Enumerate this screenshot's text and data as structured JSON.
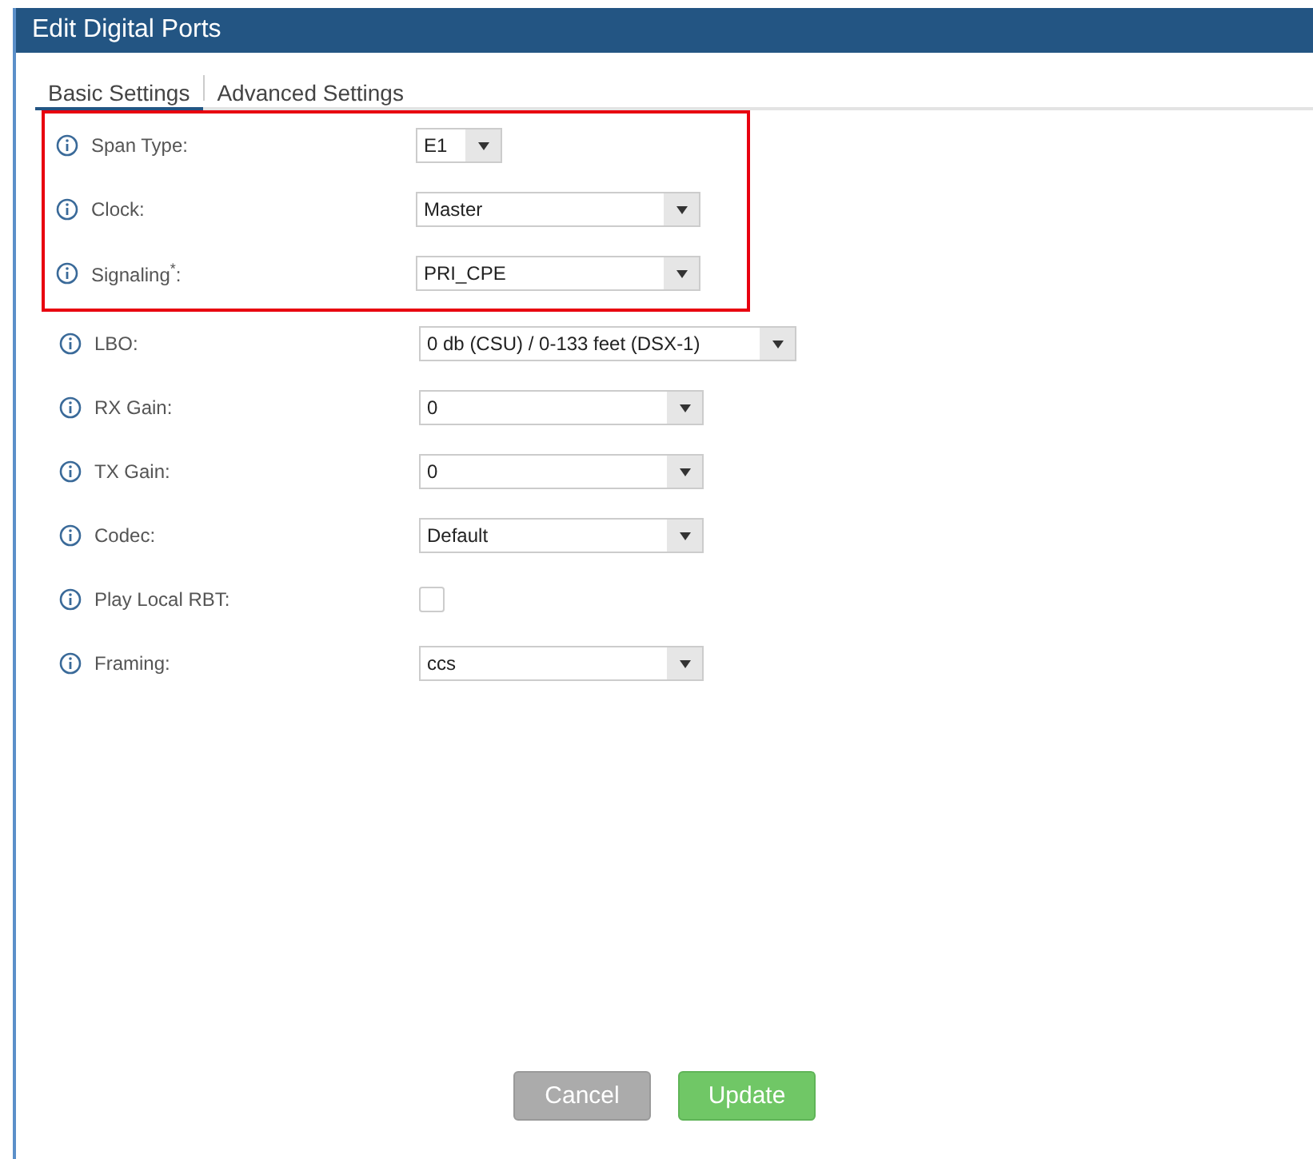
{
  "window": {
    "title": "Edit Digital Ports"
  },
  "tabs": [
    {
      "label": "Basic Settings",
      "selected": true
    },
    {
      "label": "Advanced Settings",
      "selected": false
    }
  ],
  "fields": [
    {
      "kind": "select",
      "label": "Span Type:",
      "value": "E1",
      "highlighted": true
    },
    {
      "kind": "select",
      "label": "Clock:",
      "value": "Master",
      "highlighted": true
    },
    {
      "kind": "select",
      "label": "Signaling",
      "label_mark": "*",
      "label_suffix": ":",
      "value": "PRI_CPE",
      "highlighted": true
    },
    {
      "kind": "select",
      "label": "LBO:",
      "value": "0 db (CSU) / 0-133 feet (DSX-1)",
      "highlighted": false
    },
    {
      "kind": "select",
      "label": "RX Gain:",
      "value": "0",
      "highlighted": false
    },
    {
      "kind": "select",
      "label": "TX Gain:",
      "value": "0",
      "highlighted": false
    },
    {
      "kind": "select",
      "label": "Codec:",
      "value": "Default",
      "highlighted": false
    },
    {
      "kind": "checkbox",
      "label": "Play Local RBT:",
      "checked": false,
      "highlighted": false
    },
    {
      "kind": "select",
      "label": "Framing:",
      "value": "ccs",
      "highlighted": false
    }
  ],
  "buttons": [
    {
      "label": "Cancel",
      "kind": "secondary"
    },
    {
      "label": "Update",
      "kind": "primary"
    }
  ]
}
